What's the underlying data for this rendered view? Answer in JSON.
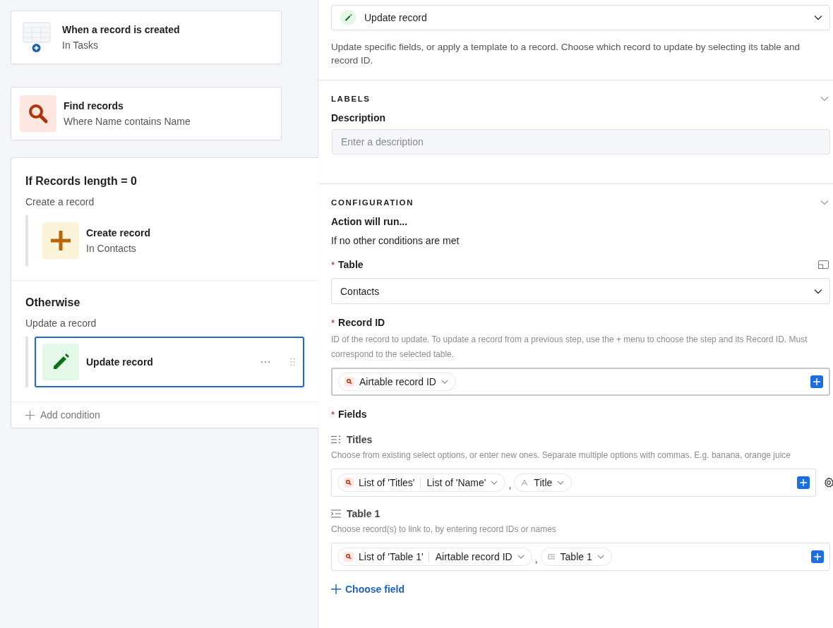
{
  "flow": {
    "steps": [
      {
        "kind": "trigger",
        "title": "When a record is created",
        "subtitle": "In Tasks"
      },
      {
        "kind": "find",
        "title": "Find records",
        "subtitle": "Where Name contains Name"
      }
    ],
    "condition_group": {
      "branches": [
        {
          "heading": "If Records length = 0",
          "subheading": "Create a record",
          "step": {
            "kind": "create",
            "title": "Create record",
            "subtitle": "In Contacts",
            "selected": false
          }
        },
        {
          "heading": "Otherwise",
          "subheading": "Update a record",
          "step": {
            "kind": "update",
            "title": "Update record",
            "selected": true
          }
        }
      ],
      "add_condition": "Add condition"
    }
  },
  "panel": {
    "action": {
      "label": "Update record"
    },
    "description": "Update specific fields, or apply a template to a record. Choose which record to update by selecting its table and record ID.",
    "required_mark": "*",
    "labels": {
      "title": "LABELS",
      "expanded": true,
      "field_label": "Description",
      "placeholder": "Enter a description"
    },
    "configuration": {
      "title": "CONFIGURATION",
      "expanded": true,
      "run_label": "Action will run...",
      "run_condition": "If no other conditions are met",
      "table": {
        "label": "Table",
        "required": true,
        "value": "Contacts"
      },
      "record_id": {
        "label": "Record ID",
        "required": true,
        "help": "ID of the record to update. To update a record from a previous step, use the + menu to choose the step and its Record ID. Must correspond to the selected table.",
        "pills": [
          {
            "kind": "lookup",
            "parts": [
              "Airtable record ID"
            ]
          }
        ]
      },
      "fields": {
        "label": "Fields",
        "required": true,
        "items": [
          {
            "kind": "select",
            "name": "Titles",
            "help": "Choose from existing select options, or enter new ones. Separate multiple options with commas. E.g. banana, orange juice",
            "separator": ",",
            "settings": true,
            "pills": [
              {
                "kind": "lookup",
                "parts": [
                  "List of 'Titles'",
                  "List of 'Name'"
                ]
              },
              {
                "kind": "text",
                "parts": [
                  "Title"
                ]
              }
            ]
          },
          {
            "kind": "link",
            "name": "Table 1",
            "help": "Choose record(s) to link to, by entering record IDs or names",
            "separator": ",",
            "settings": false,
            "pills": [
              {
                "kind": "lookup",
                "parts": [
                  "List of 'Table 1'",
                  "Airtable record ID"
                ]
              },
              {
                "kind": "link",
                "parts": [
                  "Table 1"
                ]
              }
            ]
          }
        ]
      },
      "choose_field": "Choose field"
    }
  }
}
